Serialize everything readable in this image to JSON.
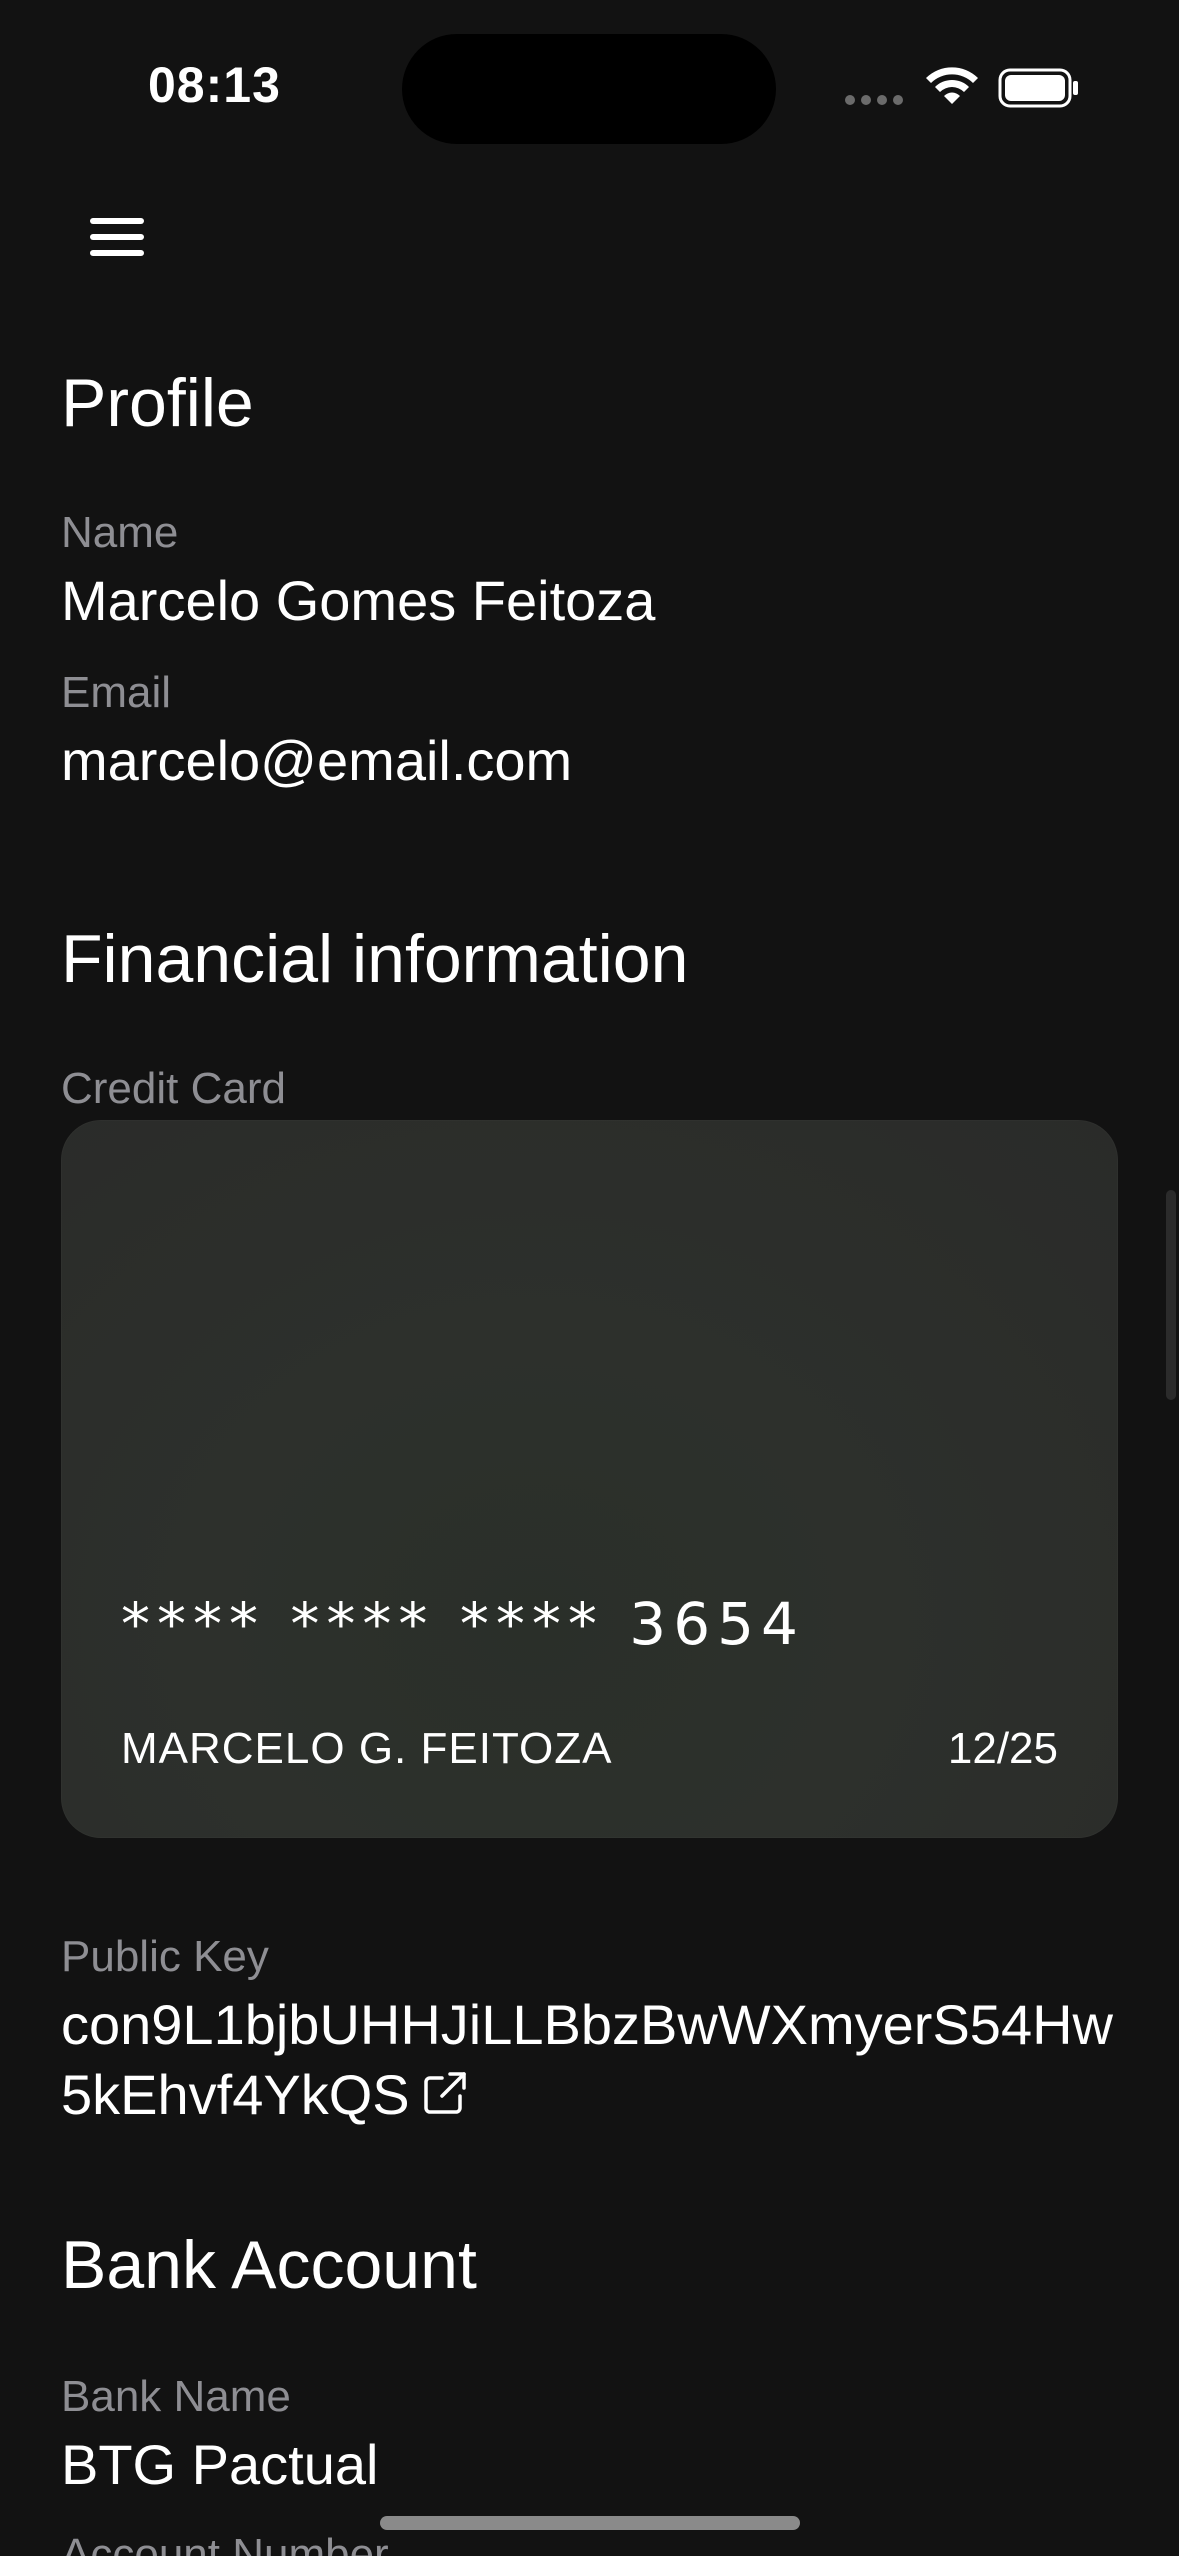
{
  "status_bar": {
    "time": "08:13"
  },
  "profile": {
    "title": "Profile",
    "name_label": "Name",
    "name_value": "Marcelo Gomes Feitoza",
    "email_label": "Email",
    "email_value": "marcelo@email.com"
  },
  "financial": {
    "title": "Financial information",
    "credit_card_label": "Credit Card",
    "card": {
      "number": "**** **** **** 3654",
      "holder": "MARCELO G. FEITOZA",
      "expiry": "12/25"
    },
    "public_key_label": "Public Key",
    "public_key_value": "con9L1bjbUHHJiLLBbzBwWXmyerS54Hw5kEhvf4YkQS"
  },
  "bank_account": {
    "title": "Bank Account",
    "bank_name_label": "Bank Name",
    "bank_name_value": "BTG Pactual",
    "account_number_label": "Account Number"
  },
  "icons": {
    "menu": "hamburger-menu-icon",
    "wifi": "wifi-icon",
    "battery": "battery-icon",
    "external_link": "external-link-icon"
  },
  "colors": {
    "background": "#121212",
    "label": "#8e8e93",
    "card": "#2d302c"
  }
}
